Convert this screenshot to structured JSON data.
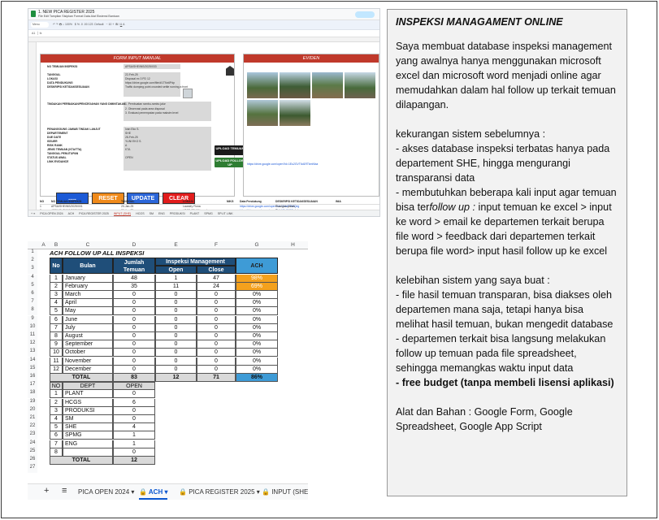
{
  "top_sheet": {
    "doc_title": "1. NEW PICA REGISTER 2025",
    "menus": "File  Edit  Tampilan  Sisipkan  Format  Data  Alat  Ekstensi  Bantuan",
    "search": "Menu",
    "zoom": "100%",
    "font": "Default",
    "cell_ref": "A1",
    "form_title": "FORM INPUT MANUAL",
    "eviden_title": "EVIDEN",
    "fields": [
      {
        "label": "NO TEMUAN INSPEKSI",
        "value": "APSA/SHE/INS/2025/033"
      },
      {
        "label": "TANGGAL",
        "value": "22-Feb-25"
      },
      {
        "label": "LOKASI",
        "value": "Disposal ex 3 PD 12"
      },
      {
        "label": "DATA PENDUKUNG",
        "value": "https://drive.google.com/file/d/1TNx6Pdp"
      },
      {
        "label": "DESKRIPSI KETIDAKSESUAIAN",
        "value": "Traffic dumping point crowded settle running a front"
      },
      {
        "label": "TINDAKAN PERBAIKAN/PENCEGAHAN YANG DIMINTAKAN",
        "value": "1. Pembuatan rambu-rambu jalur"
      },
      {
        "label": "",
        "value": "2. Observasi pada area disposal"
      },
      {
        "label": "",
        "value": "3. Evaluasi penempatan pada maksim level"
      },
      {
        "label": "PENANGGUNG JAWAB TINDAK LANJUT",
        "value": "Ivan Eko S."
      },
      {
        "label": "DEPARTEMENT",
        "value": "SHE"
      },
      {
        "label": "DUE DATE",
        "value": "28-Feb-25"
      },
      {
        "label": "ISSUER",
        "value": "YUNI EKO S."
      },
      {
        "label": "RISK RANK",
        "value": "A"
      },
      {
        "label": "JENIS TEMUAN (KTA/TTA)",
        "value": "KTA"
      },
      {
        "label": "TANGGAL PENUTUPAN",
        "value": ""
      },
      {
        "label": "STATUS AWAL",
        "value": "OPEN"
      },
      {
        "label": "LINK EVIDANCE",
        "value": ""
      }
    ],
    "upload_temuan": "UPLOAD TEMUAN",
    "upload_followup": "UPLOAD FOLLOW UP",
    "buttons": {
      "dots": ".....",
      "reset": "RESET",
      "update": "UPDATE",
      "clear": "CLEAR"
    },
    "eviden_link": "https://drive.google.com/open?id=1Eu2GVT6d1RTkmNlxa",
    "table_headers": [
      "NO",
      "NO TEMUAN INSPEKSI",
      "TANGGAL",
      "LOKASI",
      "NIKG",
      "Data Pendukung",
      "DESKRIPSI KETIDAKSESUAIAN",
      "INIA"
    ],
    "table_rows": [
      [
        "1",
        "APSA/SHE/INS/2025/001",
        "20-Jan-25",
        "Laundry Fiona",
        "",
        "https://drive.google.com/open?id=1VdaTTiWQeg",
        "Ruangan panas"
      ],
      [
        "2",
        "APSA/SHE/INS/2025/002",
        "20-Jan-25",
        "LRCS CP-12 Laundry",
        "",
        "https://drive.google.com/open?id=1GgBd4Z",
        "Pintu area bengkel"
      ]
    ],
    "tabs": [
      "PICA OPEN 2024",
      "ACH",
      "PICA REGISTER 2025",
      "INPUT (SHE)",
      "HCGS",
      "SM",
      "ENG",
      "PRODUKSI",
      "PLANT",
      "SPMG",
      "SPLIT LINK"
    ]
  },
  "bottom_sheet": {
    "columns": [
      "A",
      "B",
      "C",
      "D",
      "E",
      "F",
      "G",
      "H"
    ],
    "title": "ACH FOLLOW UP ALL INSPEKSI",
    "headers": {
      "no": "No",
      "bulan": "Bulan",
      "jumlah": "Jumlah Temuan",
      "inspeksi": "Inspeksi Management",
      "open": "Open",
      "close": "Close",
      "ach": "ACH"
    },
    "months": [
      {
        "no": "1",
        "bulan": "January",
        "jumlah": "48",
        "open": "1",
        "close": "47",
        "ach": "98%",
        "hl": true
      },
      {
        "no": "2",
        "bulan": "February",
        "jumlah": "35",
        "open": "11",
        "close": "24",
        "ach": "69%",
        "hl": true
      },
      {
        "no": "3",
        "bulan": "March",
        "jumlah": "0",
        "open": "0",
        "close": "0",
        "ach": "0%",
        "hl": false
      },
      {
        "no": "4",
        "bulan": "April",
        "jumlah": "0",
        "open": "0",
        "close": "0",
        "ach": "0%",
        "hl": false
      },
      {
        "no": "5",
        "bulan": "May",
        "jumlah": "0",
        "open": "0",
        "close": "0",
        "ach": "0%",
        "hl": false
      },
      {
        "no": "6",
        "bulan": "June",
        "jumlah": "0",
        "open": "0",
        "close": "0",
        "ach": "0%",
        "hl": false
      },
      {
        "no": "7",
        "bulan": "July",
        "jumlah": "0",
        "open": "0",
        "close": "0",
        "ach": "0%",
        "hl": false
      },
      {
        "no": "8",
        "bulan": "August",
        "jumlah": "0",
        "open": "0",
        "close": "0",
        "ach": "0%",
        "hl": false
      },
      {
        "no": "9",
        "bulan": "September",
        "jumlah": "0",
        "open": "0",
        "close": "0",
        "ach": "0%",
        "hl": false
      },
      {
        "no": "10",
        "bulan": "October",
        "jumlah": "0",
        "open": "0",
        "close": "0",
        "ach": "0%",
        "hl": false
      },
      {
        "no": "11",
        "bulan": "November",
        "jumlah": "0",
        "open": "0",
        "close": "0",
        "ach": "0%",
        "hl": false
      },
      {
        "no": "12",
        "bulan": "December",
        "jumlah": "0",
        "open": "0",
        "close": "0",
        "ach": "0%",
        "hl": false
      }
    ],
    "total": {
      "label": "TOTAL",
      "jumlah": "83",
      "open": "12",
      "close": "71",
      "ach": "86%"
    },
    "dept_headers": {
      "no": "NO",
      "dept": "DEPT",
      "open": "OPEN"
    },
    "depts": [
      {
        "no": "1",
        "dept": "PLANT",
        "open": "0"
      },
      {
        "no": "2",
        "dept": "HCGS",
        "open": "6"
      },
      {
        "no": "3",
        "dept": "PRODUKSI",
        "open": "0"
      },
      {
        "no": "4",
        "dept": "SM",
        "open": "0"
      },
      {
        "no": "5",
        "dept": "SHE",
        "open": "4"
      },
      {
        "no": "6",
        "dept": "SPMG",
        "open": "1"
      },
      {
        "no": "7",
        "dept": "ENG",
        "open": "1"
      },
      {
        "no": "8",
        "dept": "",
        "open": "0"
      }
    ],
    "dept_total": {
      "label": "TOTAL",
      "open": "12"
    },
    "tabs": [
      "PICA OPEN 2024",
      "ACH",
      "PICA REGISTER 2025",
      "INPUT (SHE)"
    ],
    "colors": {
      "header_blue": "#1f4e79",
      "ach_blue": "#3e9bd6",
      "highlight_orange": "#f4a11d",
      "gray_fill": "#d9d9d9"
    }
  },
  "panel": {
    "title": "INSPEKSI MANAGAMENT ONLINE",
    "intro": "Saya membuat database inspeksi management yang awalnya hanya menggunakan microsoft excel dan microsoft word menjadi online agar memudahkan dalam hal follow up terkait temuan dilapangan.",
    "kekurangan_title": "kekurangan sistem sebelumnya :",
    "kekurangan_1": "- akses database inspeksi terbatas hanya pada departement SHE, hingga mengurangi transparansi data",
    "kekurangan_2a": "- membutuhkan beberapa kali input agar temuan bisa ter",
    "kekurangan_2b": "follow up :",
    "kekurangan_2c": " input temuan ke excel > input ke word > email ke departemen terkait berupa file word > feedback dari departemen terkait berupa file word> input hasil follow up ke excel",
    "kelebihan_title": "kelebihan sistem yang saya buat :",
    "kelebihan_1": "- file hasil temuan transparan, bisa diakses oleh departemen mana saja, tetapi hanya bisa melihat hasil temuan, bukan mengedit database",
    "kelebihan_2": "- departemen terkait bisa langsung melakukan follow up temuan pada file spreadsheet, sehingga memangkas waktu input data",
    "kelebihan_3": "- free budget (tanpa membeli lisensi aplikasi)",
    "alat": "Alat dan Bahan : Google Form, Google Spreadsheet, Google App Script"
  }
}
